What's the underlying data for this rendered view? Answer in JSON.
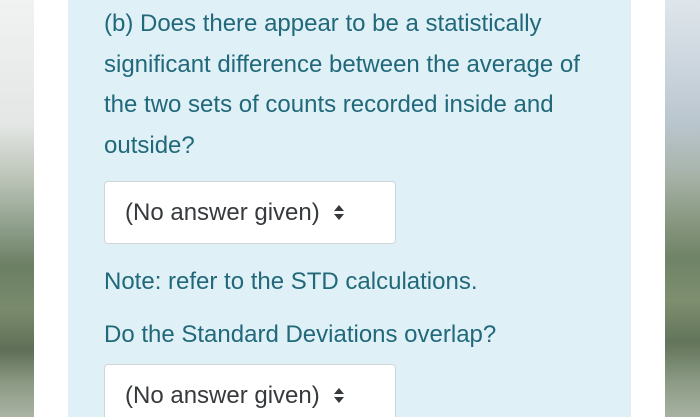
{
  "question_b": {
    "text": "(b) Does there appear to be a statistically significant difference between the average of the two sets of counts recorded inside and outside?",
    "select_value": "(No answer given)"
  },
  "note": {
    "text": "Note: refer to the STD calculations."
  },
  "question_std": {
    "text": "Do the Standard Deviations overlap?",
    "select_value": "(No answer given)"
  },
  "icons": {
    "select_caret": "up-down-caret-icon"
  },
  "colors": {
    "panel_bg": "#dff0f7",
    "text": "#21697a",
    "select_text": "#373a3c",
    "select_bg": "#ffffff"
  }
}
